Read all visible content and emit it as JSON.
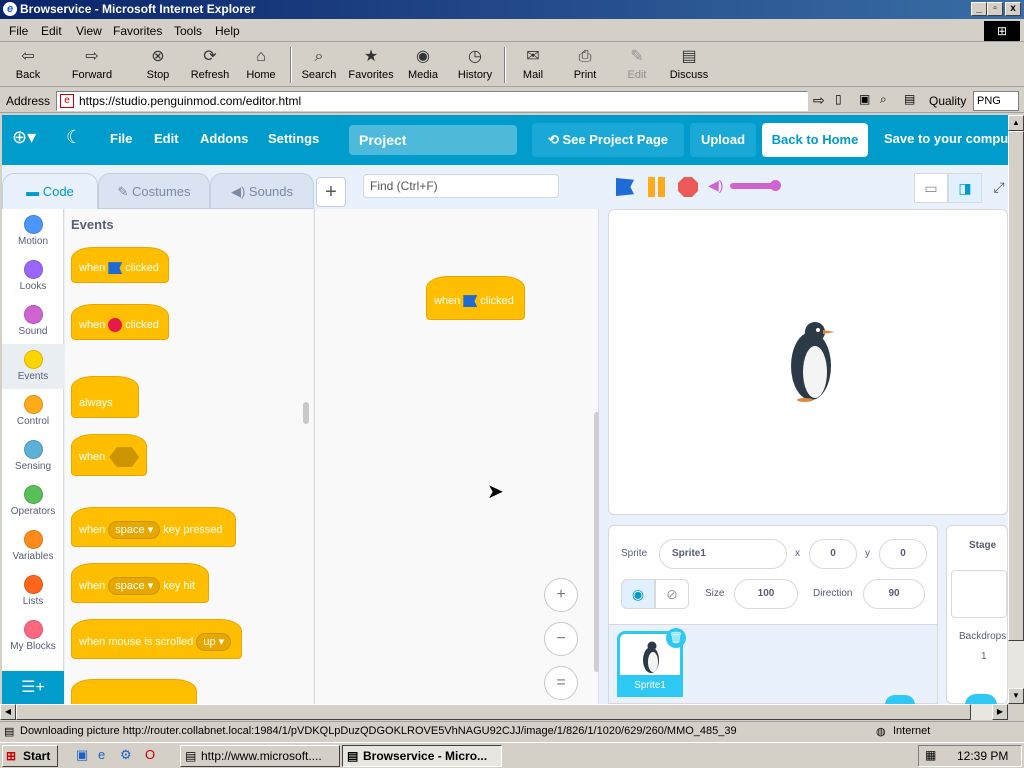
{
  "window": {
    "title": "Browservice - Microsoft Internet Explorer",
    "min": "_",
    "max": "▫",
    "close": "x"
  },
  "menu": [
    "File",
    "Edit",
    "View",
    "Favorites",
    "Tools",
    "Help"
  ],
  "toolbar": {
    "back": "Back",
    "forward": "Forward",
    "stop": "Stop",
    "refresh": "Refresh",
    "home": "Home",
    "search": "Search",
    "favorites": "Favorites",
    "media": "Media",
    "history": "History",
    "mail": "Mail",
    "print": "Print",
    "edit": "Edit",
    "discuss": "Discuss"
  },
  "address": {
    "label": "Address",
    "url": "https://studio.penguinmod.com/editor.html",
    "quality_label": "Quality",
    "quality_value": "PNG"
  },
  "pm": {
    "menu": {
      "file": "File",
      "edit": "Edit",
      "addons": "Addons",
      "settings": "Settings"
    },
    "project_title": "Project",
    "see_project_page": "See Project Page",
    "upload": "Upload",
    "back_home": "Back to Home",
    "save": "Save to your computer",
    "tabs": {
      "code": "Code",
      "costumes": "Costumes",
      "sounds": "Sounds"
    },
    "find_placeholder": "Find (Ctrl+F)",
    "categories": [
      {
        "label": "Motion",
        "color": "#4c97ff"
      },
      {
        "label": "Looks",
        "color": "#9966ff"
      },
      {
        "label": "Sound",
        "color": "#cf63cf"
      },
      {
        "label": "Events",
        "color": "#ffd500"
      },
      {
        "label": "Control",
        "color": "#ffab19"
      },
      {
        "label": "Sensing",
        "color": "#5cb1d6"
      },
      {
        "label": "Operators",
        "color": "#59c059"
      },
      {
        "label": "Variables",
        "color": "#ff8c1a"
      },
      {
        "label": "Lists",
        "color": "#ff661a"
      },
      {
        "label": "My Blocks",
        "color": "#ff6680"
      }
    ],
    "palette": {
      "heading": "Events",
      "flag_when": "when",
      "flag_clicked": "clicked",
      "stop_when": "when",
      "stop_clicked": "clicked",
      "always": "always",
      "when_cond": "when",
      "key_when": "when",
      "key_space": "space",
      "key_pressed": "key pressed",
      "hit_when": "when",
      "hit_space": "space",
      "hit_text": "key hit",
      "scroll_text": "when mouse is scrolled",
      "scroll_dir": "up"
    },
    "ws_block": {
      "when": "when",
      "clicked": "clicked"
    },
    "zoom": {
      "in": "+",
      "out": "−",
      "reset": "="
    },
    "sprite": {
      "label": "Sprite",
      "name": "Sprite1",
      "x_label": "x",
      "x": "0",
      "y_label": "y",
      "y": "0",
      "size_label": "Size",
      "size": "100",
      "direction_label": "Direction",
      "direction": "90",
      "thumb_label": "Sprite1"
    },
    "stage_pane": {
      "title": "Stage",
      "backdrops_label": "Backdrops",
      "backdrops_count": "1"
    }
  },
  "status": {
    "text": "Downloading picture http://router.collabnet.local:1984/1/pVDKQLpDuzQDGOKLROVE5VhNAGU92CJJ/image/1/826/1/1020/629/260/MMO_485_39",
    "zone": "Internet"
  },
  "taskbar": {
    "start": "Start",
    "task1": "http://www.microsoft....",
    "task2": "Browservice - Micro...",
    "clock": "12:39 PM"
  }
}
